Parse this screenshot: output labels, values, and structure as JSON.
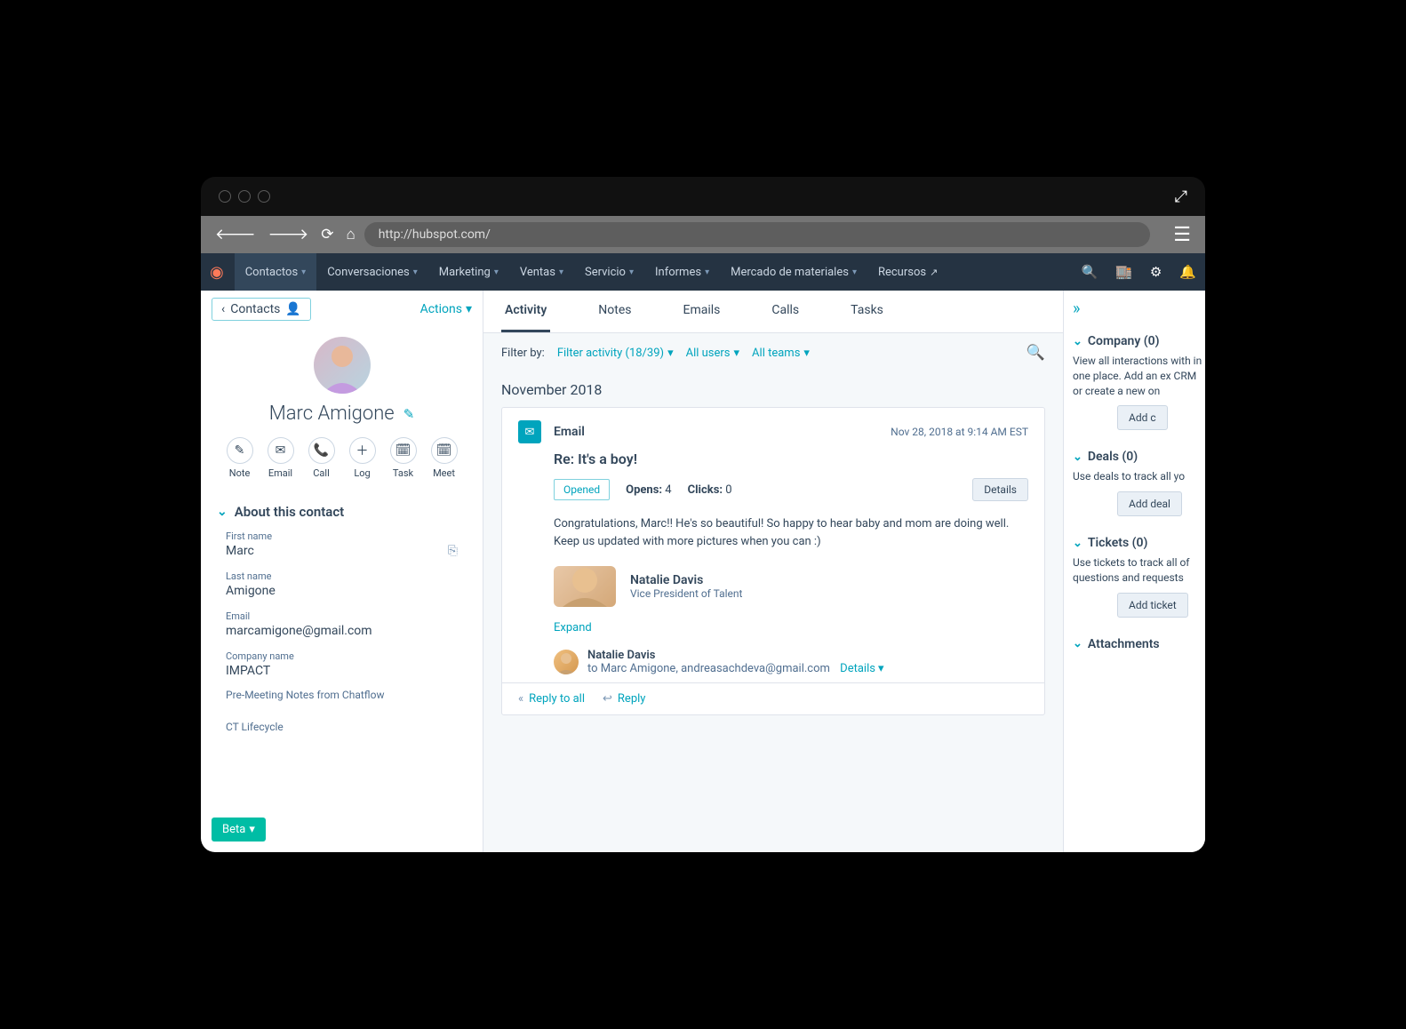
{
  "browser": {
    "url": "http://hubspot.com/"
  },
  "topnav": {
    "items": [
      "Contactos",
      "Conversaciones",
      "Marketing",
      "Ventas",
      "Servicio",
      "Informes",
      "Mercado de materiales",
      "Recursos"
    ],
    "active_index": 0
  },
  "left": {
    "crumb": "Contacts",
    "actions": "Actions",
    "contact_name": "Marc Amigone",
    "actions_row": [
      {
        "icon": "✎",
        "label": "Note"
      },
      {
        "icon": "✉",
        "label": "Email"
      },
      {
        "icon": "📞",
        "label": "Call"
      },
      {
        "icon": "＋",
        "label": "Log"
      },
      {
        "icon": "🗓",
        "label": "Task"
      },
      {
        "icon": "🗓",
        "label": "Meet"
      }
    ],
    "about_header": "About this contact",
    "fields": {
      "first_name": {
        "label": "First name",
        "value": "Marc"
      },
      "last_name": {
        "label": "Last name",
        "value": "Amigone"
      },
      "email": {
        "label": "Email",
        "value": "marcamigone@gmail.com"
      },
      "company": {
        "label": "Company name",
        "value": "IMPACT"
      }
    },
    "note1": "Pre-Meeting Notes from Chatflow",
    "note2": "CT Lifecycle",
    "beta": "Beta"
  },
  "mid": {
    "tabs": [
      "Activity",
      "Notes",
      "Emails",
      "Calls",
      "Tasks"
    ],
    "active_tab": 0,
    "filter": {
      "label": "Filter by:",
      "activity": "Filter activity (18/39)",
      "users": "All users",
      "teams": "All teams"
    },
    "month": "November 2018",
    "email": {
      "type": "Email",
      "date": "Nov 28, 2018 at 9:14 AM EST",
      "subject": "Re: It's a boy!",
      "opened": "Opened",
      "opens_label": "Opens:",
      "opens_count": "4",
      "clicks_label": "Clicks:",
      "clicks_count": "0",
      "details_btn": "Details",
      "body": "Congratulations, Marc!! He's so beautiful! So happy to hear baby and mom are doing well. Keep us updated with more pictures when you can :)",
      "sig_name": "Natalie Davis",
      "sig_title": "Vice President of Talent",
      "expand": "Expand",
      "from_name": "Natalie Davis",
      "from_to": "to Marc Amigone, andreasachdeva@gmail.com",
      "details_link": "Details",
      "reply_all": "Reply to all",
      "reply": "Reply"
    }
  },
  "right": {
    "sections": [
      {
        "title": "Company (0)",
        "desc": "View all interactions with in one place. Add an ex CRM or create a new on",
        "btn": "Add c"
      },
      {
        "title": "Deals (0)",
        "desc": "Use deals to track all yo",
        "btn": "Add deal"
      },
      {
        "title": "Tickets (0)",
        "desc": "Use tickets to track all of questions and requests",
        "btn": "Add ticket"
      },
      {
        "title": "Attachments",
        "desc": "",
        "btn": ""
      }
    ]
  }
}
